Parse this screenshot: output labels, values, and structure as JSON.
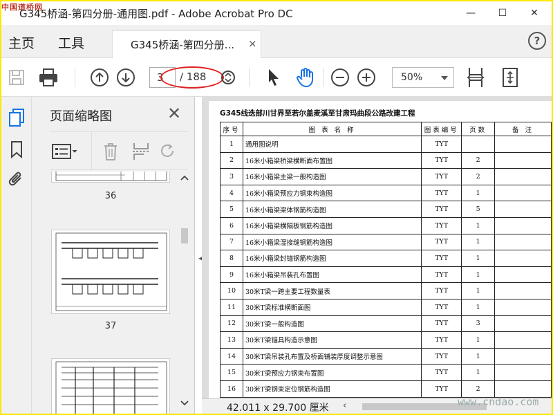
{
  "window": {
    "title": "G345桥涵-第四分册-通用图.pdf - Adobe Acrobat Pro DC",
    "logo_text": "中国道桥网",
    "minimize": "—",
    "maximize": "☐",
    "close": "✕"
  },
  "menu": {
    "home": "主页",
    "tools": "工具",
    "doc_tab": "G345桥涵-第四分册...",
    "doc_tab_close": "×",
    "help": "?"
  },
  "toolbar": {
    "current_page": "3",
    "total_pages": "/ 188",
    "zoom": "50%"
  },
  "panel": {
    "title": "页面缩略图",
    "close": "✕",
    "thumbnails": [
      {
        "label": "36"
      },
      {
        "label": "37"
      },
      {
        "label": ""
      }
    ]
  },
  "document": {
    "project_title": "G345线迭部川甘界至若尔盖麦溪至甘肃玛曲段公路改建工程",
    "headers": {
      "no": "序号",
      "name": "图 表 名 称",
      "code": "图表编号",
      "pages": "页数",
      "note": "备 注"
    },
    "rows": [
      {
        "no": "1",
        "name": "通用图说明",
        "code": "TYT",
        "pages": ""
      },
      {
        "no": "2",
        "name": "16米小箱梁桥梁横断面布置图",
        "code": "TYT",
        "pages": "2"
      },
      {
        "no": "3",
        "name": "16米小箱梁主梁一般构造图",
        "code": "TYT",
        "pages": "2"
      },
      {
        "no": "4",
        "name": "16米小箱梁预应力钢束构造图",
        "code": "TYT",
        "pages": "1"
      },
      {
        "no": "5",
        "name": "16米小箱梁梁体钢筋构造图",
        "code": "TYT",
        "pages": "5"
      },
      {
        "no": "6",
        "name": "16米小箱梁横隔板钢筋构造图",
        "code": "TYT",
        "pages": "1"
      },
      {
        "no": "7",
        "name": "16米小箱梁湿接缝钢筋构造图",
        "code": "TYT",
        "pages": "1"
      },
      {
        "no": "8",
        "name": "16米小箱梁封锚钢筋构造图",
        "code": "TYT",
        "pages": "1"
      },
      {
        "no": "9",
        "name": "16米小箱梁吊装孔布置图",
        "code": "TYT",
        "pages": "1"
      },
      {
        "no": "10",
        "name": "30米T梁一跨主要工程数量表",
        "code": "TYT",
        "pages": "1"
      },
      {
        "no": "11",
        "name": "30米T梁标准横断面图",
        "code": "TYT",
        "pages": "1"
      },
      {
        "no": "12",
        "name": "30米T梁一般构造图",
        "code": "TYT",
        "pages": "3"
      },
      {
        "no": "13",
        "name": "30米T梁锚具构造示意图",
        "code": "TYT",
        "pages": "1"
      },
      {
        "no": "14",
        "name": "30米T梁吊装孔布置及桥面铺装厚度调整示意图",
        "code": "TYT",
        "pages": "1"
      },
      {
        "no": "15",
        "name": "30米T梁预应力钢束布置图",
        "code": "TYT",
        "pages": "1"
      },
      {
        "no": "16",
        "name": "30米T梁钢束定位钢筋构造图",
        "code": "TYT",
        "pages": "2"
      }
    ]
  },
  "status": {
    "page_size": "42.011 x 29.700 厘米"
  },
  "watermark": "www.cndao.com",
  "colors": {
    "accent_blue": "#1473e6",
    "frame_yellow": "#ffe700",
    "annotation_red": "#e02020"
  }
}
